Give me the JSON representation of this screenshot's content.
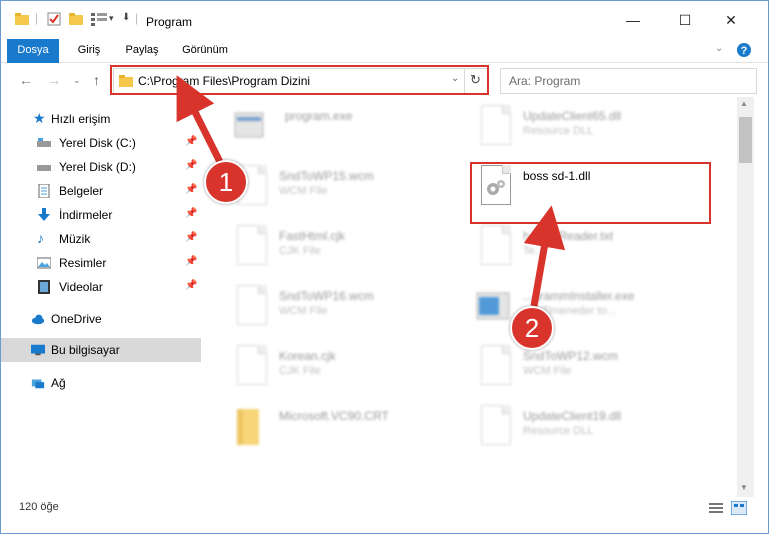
{
  "window": {
    "title": "Program",
    "controls": [
      "minimize-icon",
      "maximize-icon",
      "close-icon"
    ]
  },
  "ribbon": {
    "tabs": [
      "Dosya",
      "Giriş",
      "Paylaş",
      "Görünüm"
    ]
  },
  "navigation": {
    "address": "C:\\Program Files\\Program Dizini",
    "search_placeholder": "Ara: Program"
  },
  "sidebar": {
    "quick_access": "Hızlı erişim",
    "items": [
      {
        "label": "Yerel Disk (C:)",
        "icon": "drive-icon",
        "pinned": true
      },
      {
        "label": "Yerel Disk (D:)",
        "icon": "drive-icon",
        "pinned": true
      },
      {
        "label": "Belgeler",
        "icon": "documents-icon",
        "pinned": true
      },
      {
        "label": "İndirmeler",
        "icon": "download-icon",
        "pinned": true
      },
      {
        "label": "Müzik",
        "icon": "music-icon",
        "pinned": true
      },
      {
        "label": "Resimler",
        "icon": "pictures-icon",
        "pinned": true
      },
      {
        "label": "Videolar",
        "icon": "videos-icon",
        "pinned": true
      }
    ],
    "onedrive": "OneDrive",
    "this_pc": "Bu bilgisayar",
    "network": "Ağ"
  },
  "files": {
    "left": [
      {
        "name": "program.exe",
        "type": ""
      },
      {
        "name": "SndToWP15.wcm",
        "type": "WCM File"
      },
      {
        "name": "FastHtml.cjk",
        "type": "CJK File"
      },
      {
        "name": "SndToWP16.wcm",
        "type": "WCM File"
      },
      {
        "name": "Korean.cjk",
        "type": "CJK File"
      },
      {
        "name": "Microsoft.VC90.CRT",
        "type": ""
      }
    ],
    "right": [
      {
        "name": "UpdateClient65.dll",
        "type": "Resource DLL"
      },
      {
        "name": "boss sd-1.dll",
        "type": ""
      },
      {
        "name": "h...lineReader.txt",
        "type": "Te..."
      },
      {
        "name": "...grammInstaller.exe",
        "type": "...P Timeneder to..."
      },
      {
        "name": "SndToWP12.wcm",
        "type": "WCM File"
      },
      {
        "name": "UpdateClient19.dll",
        "type": "Resource DLL"
      }
    ]
  },
  "status": {
    "count": "120 öğe"
  },
  "annotations": {
    "step1": "1",
    "step2": "2",
    "color": "#d9342b"
  }
}
